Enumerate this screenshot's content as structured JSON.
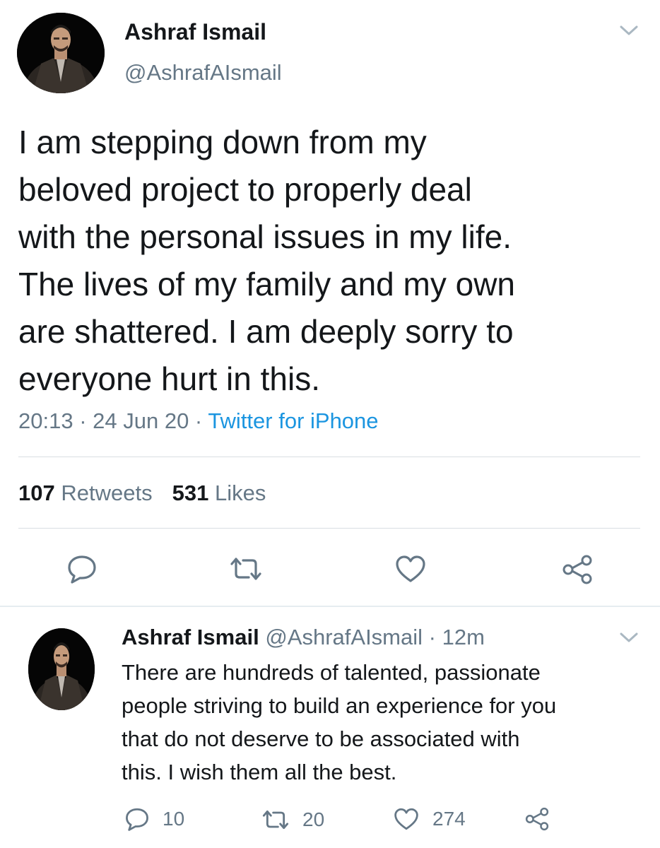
{
  "main_tweet": {
    "author_name": "Ashraf Ismail",
    "author_handle": "@AshrafAIsmail",
    "text": "I am stepping down from my\nbeloved project to properly deal\nwith the personal issues in my life.\nThe lives of my family and my own\nare shattered. I am deeply sorry to\neveryone hurt in this.",
    "time": "20:13",
    "date": "24 Jun 20",
    "source": "Twitter for iPhone",
    "separator": " · ",
    "retweets_count": "107",
    "retweets_label": "Retweets",
    "likes_count": "531",
    "likes_label": "Likes"
  },
  "reply_tweet": {
    "author_name": "Ashraf Ismail",
    "author_handle": "@AshrafAIsmail",
    "time_ago": "· 12m",
    "text": "There are hundreds of talented, passionate\npeople striving to build an experience for you\nthat do not deserve to be associated with\nthis. I wish them all the best.",
    "reply_count": "10",
    "retweet_count": "20",
    "like_count": "274"
  },
  "icons": {
    "reply": "reply-bubble-icon",
    "retweet": "retweet-arrows-icon",
    "like": "heart-icon",
    "share": "share-nodes-icon",
    "more": "chevron-down-icon"
  },
  "colors": {
    "text": "#14171a",
    "muted": "#657786",
    "link": "#1b95e0",
    "divider": "#d9dee2"
  }
}
